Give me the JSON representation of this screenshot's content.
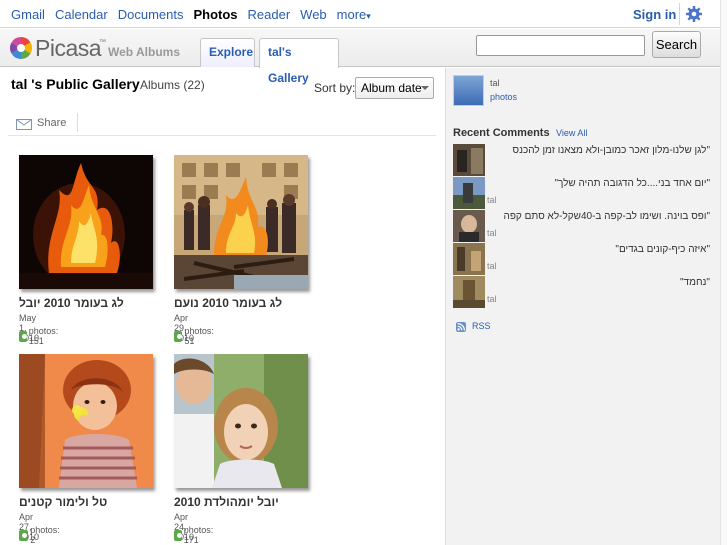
{
  "gbar": {
    "nav": [
      "Gmail",
      "Calendar",
      "Documents",
      "Photos",
      "Reader",
      "Web"
    ],
    "more": "more",
    "signin": "Sign in"
  },
  "header": {
    "logo": "Picasa",
    "tm": "™",
    "logo_sub": "Web Albums",
    "tabs": [
      "Explore",
      "tal's Gallery"
    ],
    "search_value": "",
    "search_button": "Search"
  },
  "main": {
    "title": "tal 's Public Gallery",
    "subtitle": "Albums (22)",
    "sort_label": "Sort by:",
    "sort_value": "Album date",
    "share": "Share",
    "albums": [
      {
        "name": "לג בעומר 2010 יובל",
        "date": "May 1, 2010",
        "photos": "photos: 151"
      },
      {
        "name": "לג בעומר 2010 נועם",
        "date": "Apr 29, 2010",
        "photos": "photos: 51"
      },
      {
        "name": "טל ולימור קטנים",
        "date": "Apr 27, 2010",
        "photos": "photos: 2"
      },
      {
        "name": "יובל יומהולדת 2010",
        "date": "Apr 24, 2010",
        "photos": "photos: 171"
      }
    ]
  },
  "sidebar": {
    "owner_name": "tal",
    "owner_photos": "photos",
    "recent_title": "Recent Comments",
    "view_all": "View All",
    "comments": [
      {
        "text": "\"לגן שלנו-מלון זאכר כמובן-ולא מצאנו זמן להכנס",
        "user": "tal"
      },
      {
        "text": "\"יום אחד בני....כל הדגובה תהיה שלך\"",
        "user": "tal"
      },
      {
        "text": "\"ופס בוינה. ושימו לב-קפה ב-40שקל-לא סתם קפה",
        "user": "tal"
      },
      {
        "text": "\"איזה כיף-קונים בגדים\"",
        "user": "tal"
      },
      {
        "text": "\"נחמד\"",
        "user": "tal"
      }
    ],
    "rss": "RSS"
  },
  "colors": {
    "link": "#2a5db0",
    "sidebar_bg": "#f2f2f2",
    "brand_green": "#5aa84a"
  }
}
